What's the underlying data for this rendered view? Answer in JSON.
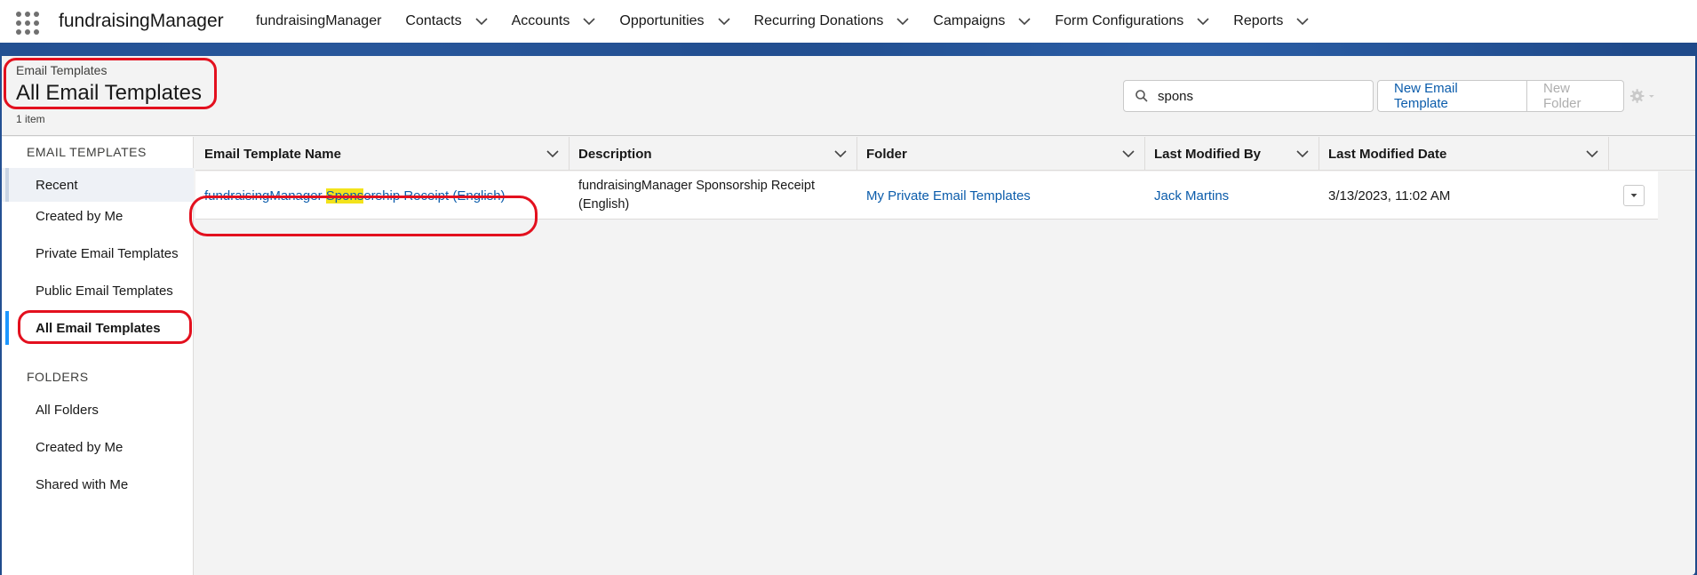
{
  "app": {
    "name": "fundraisingManager"
  },
  "nav": {
    "items": [
      {
        "label": "fundraisingManager",
        "dropdown": false
      },
      {
        "label": "Contacts",
        "dropdown": true
      },
      {
        "label": "Accounts",
        "dropdown": true
      },
      {
        "label": "Opportunities",
        "dropdown": true
      },
      {
        "label": "Recurring Donations",
        "dropdown": true
      },
      {
        "label": "Campaigns",
        "dropdown": true
      },
      {
        "label": "Form Configurations",
        "dropdown": true
      },
      {
        "label": "Reports",
        "dropdown": true
      }
    ]
  },
  "header": {
    "breadcrumb": "Email Templates",
    "title": "All Email Templates",
    "count": "1 item"
  },
  "search": {
    "value": "spons"
  },
  "buttons": {
    "new_template": "New Email Template",
    "new_folder": "New Folder"
  },
  "sidebar": {
    "section_templates": "EMAIL TEMPLATES",
    "template_items": [
      "Recent",
      "Created by Me",
      "Private Email Templates",
      "Public Email Templates",
      "All Email Templates"
    ],
    "section_folders": "FOLDERS",
    "folder_items": [
      "All Folders",
      "Created by Me",
      "Shared with Me"
    ]
  },
  "table": {
    "columns": [
      "Email Template Name",
      "Description",
      "Folder",
      "Last Modified By",
      "Last Modified Date"
    ],
    "rows": [
      {
        "name_pre": "fundraisingManager ",
        "name_hl": "Spons",
        "name_post": "orship Receipt (English)",
        "description_line1": "fundraisingManager Sponsorship Receipt",
        "description_line2": "(English)",
        "folder": "My Private Email Templates",
        "modified_by": "Jack Martins",
        "modified_date": "3/13/2023, 11:02 AM"
      }
    ]
  },
  "colors": {
    "link": "#0b5cab",
    "highlight": "#f3e31b",
    "annotation": "#e3101e",
    "band": "#1f4a8a"
  }
}
